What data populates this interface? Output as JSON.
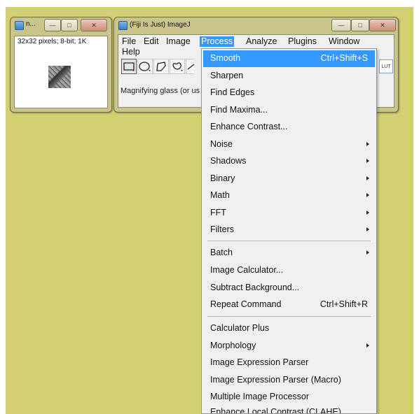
{
  "image_window": {
    "title": "n...",
    "info": "32x32 pixels; 8-bit; 1K",
    "controls": {
      "minimize": "—",
      "maximize": "□",
      "close": "✕"
    }
  },
  "main_window": {
    "title": "(Fiji Is Just) ImageJ",
    "controls": {
      "minimize": "—",
      "maximize": "□",
      "close": "✕"
    },
    "menubar": {
      "file": "File",
      "edit": "Edit",
      "image": "Image",
      "process": "Process",
      "analyze": "Analyze",
      "plugins": "Plugins",
      "window": "Window",
      "help": "Help"
    },
    "status": "Magnifying glass (or us",
    "lut_label": "LUT"
  },
  "process_menu": {
    "items": [
      {
        "label": "Smooth",
        "shortcut": "Ctrl+Shift+S"
      },
      {
        "label": "Sharpen"
      },
      {
        "label": "Find Edges"
      },
      {
        "label": "Find Maxima..."
      },
      {
        "label": "Enhance Contrast..."
      },
      {
        "label": "Noise"
      },
      {
        "label": "Shadows"
      },
      {
        "label": "Binary"
      },
      {
        "label": "Math"
      },
      {
        "label": "FFT"
      },
      {
        "label": "Filters"
      },
      {
        "label": "Batch"
      },
      {
        "label": "Image Calculator..."
      },
      {
        "label": "Subtract Background..."
      },
      {
        "label": "Repeat Command",
        "shortcut": "Ctrl+Shift+R"
      },
      {
        "label": "Calculator Plus"
      },
      {
        "label": "Morphology"
      },
      {
        "label": "Image Expression Parser"
      },
      {
        "label": "Image Expression Parser (Macro)"
      },
      {
        "label": "Multiple Image Processor"
      },
      {
        "label": "Enhance Local Contrast (CLAHE)"
      }
    ]
  },
  "colors": {
    "desktop": "#d2d071",
    "menu_highlight": "#3399ff"
  }
}
